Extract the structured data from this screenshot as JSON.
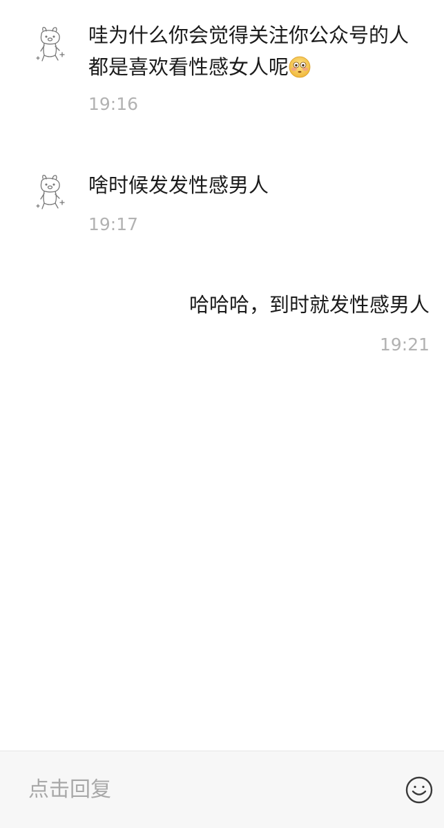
{
  "messages": [
    {
      "sender": "other",
      "avatar_icon": "cartoon-bunny-avatar-icon",
      "line1": "哇为什么你会觉得关注你公众号的人",
      "line2": "都是喜欢看性感女人呢",
      "trailing_emoji": "flushed-face-emoji",
      "time": "19:16"
    },
    {
      "sender": "other",
      "avatar_icon": "cartoon-bunny-avatar-icon",
      "line1": "啥时候发发性感男人",
      "time": "19:17"
    },
    {
      "sender": "self",
      "line1": "哈哈哈，到时就发性感男人",
      "time": "19:21"
    }
  ],
  "footer": {
    "reply_placeholder": "点击回复",
    "emoji_button_icon": "smiley-face-icon"
  },
  "colors": {
    "text": "#1b1b1b",
    "timestamp": "#b2b2b2",
    "footer_bg": "#f7f7f7",
    "placeholder": "#a8a8a8"
  }
}
